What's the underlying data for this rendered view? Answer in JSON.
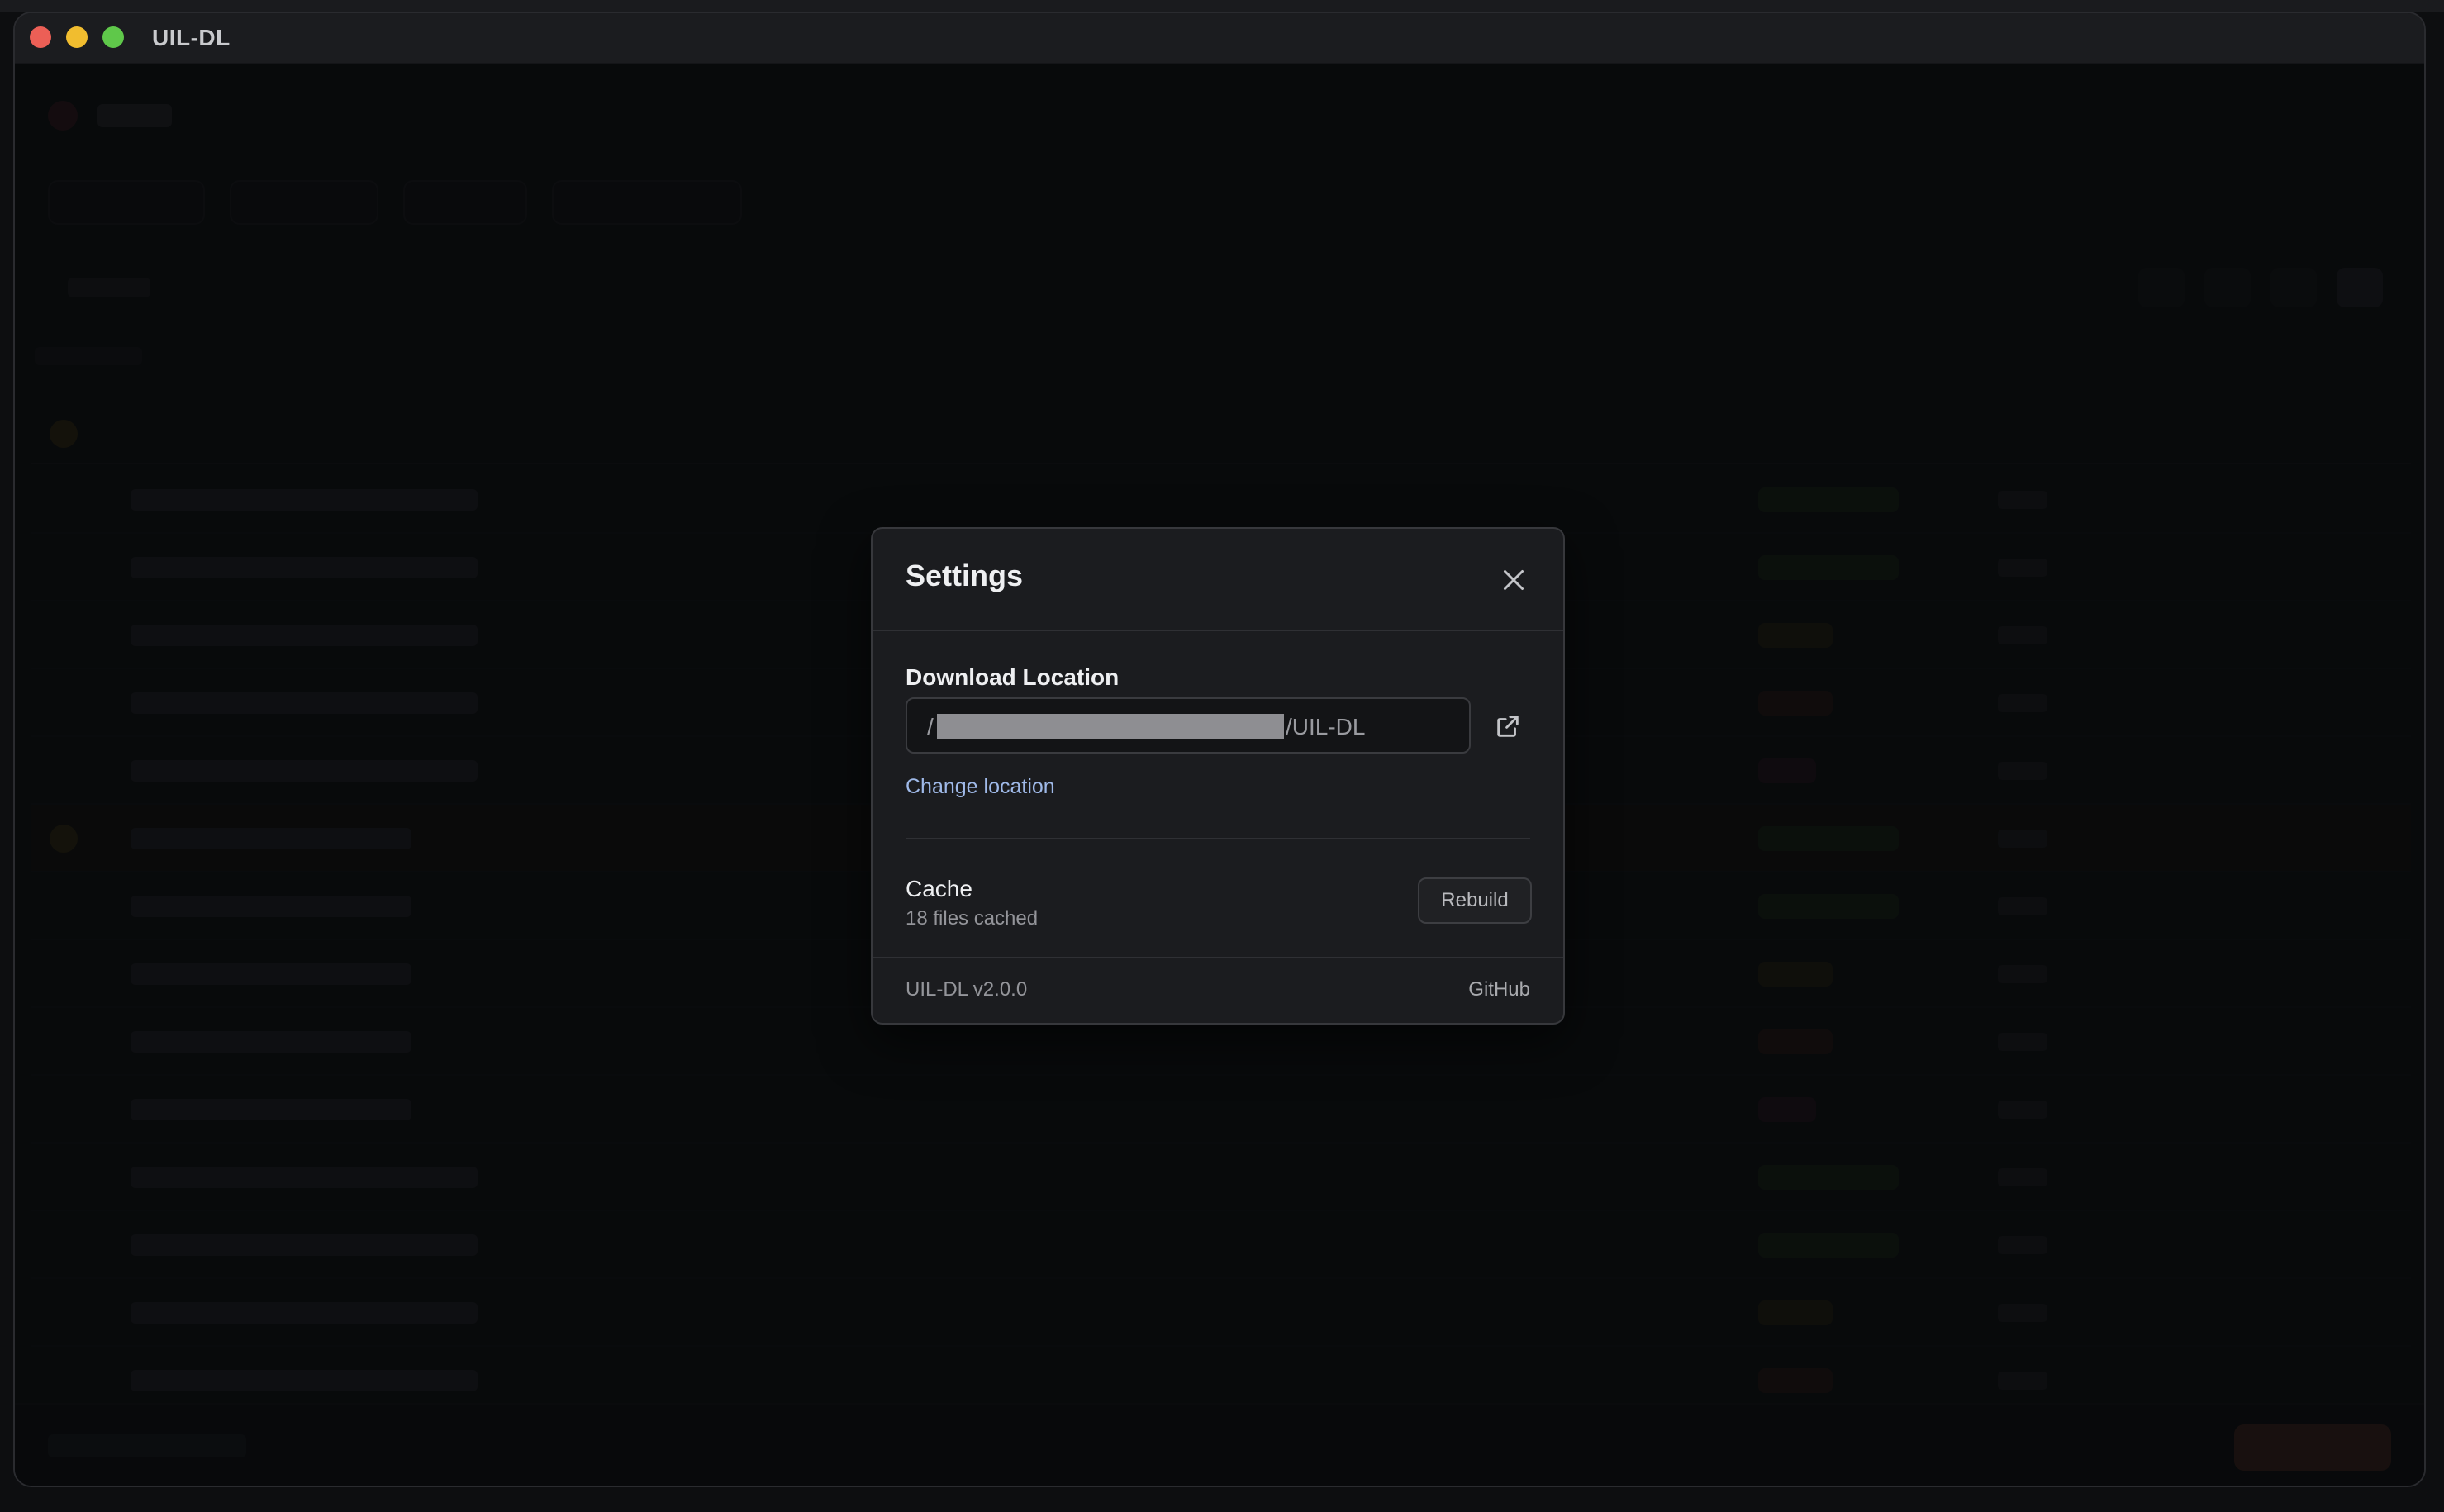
{
  "window": {
    "title": "UIL-DL"
  },
  "settings": {
    "title": "Settings",
    "download_location": {
      "label": "Download Location",
      "path_prefix": "/",
      "path_suffix": "/UIL-DL",
      "change_label": "Change location"
    },
    "cache": {
      "label": "Cache",
      "status": "18 files cached",
      "rebuild_label": "Rebuild"
    },
    "footer": {
      "version": "UIL-DL v2.0.0",
      "github_label": "GitHub"
    }
  },
  "colors": {
    "accent_link": "#9fb9e8",
    "modal_bg": "#1b1c1f",
    "close_red": "#ec5f56",
    "minimize_yellow": "#f1bd2f",
    "maximize_green": "#5fc84a"
  },
  "icons": {
    "close": "close-icon",
    "open_folder": "external-link-icon"
  }
}
